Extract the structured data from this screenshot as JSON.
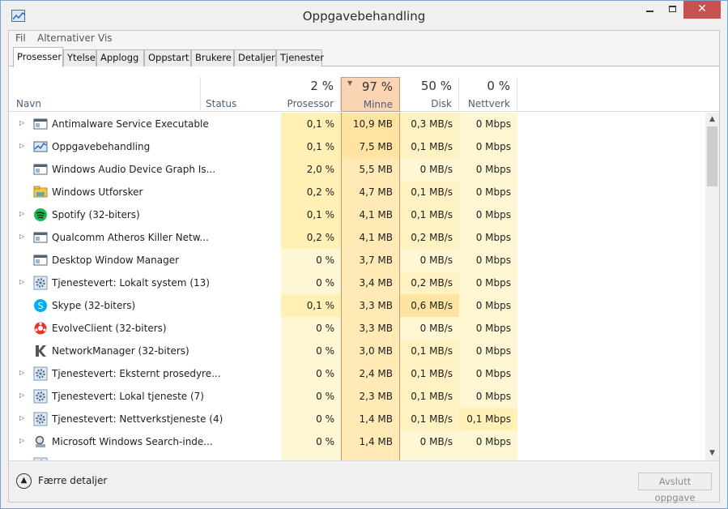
{
  "window": {
    "title": "Oppgavebehandling",
    "icon": "task-manager-icon",
    "min": "minimize-icon",
    "max": "maximize-icon",
    "close": "✕"
  },
  "menu": [
    "Fil",
    "Alternativer",
    "Vis"
  ],
  "tabs": [
    {
      "label": "Prosesser",
      "active": true
    },
    {
      "label": "Ytelse"
    },
    {
      "label": "Applogg"
    },
    {
      "label": "Oppstart"
    },
    {
      "label": "Brukere"
    },
    {
      "label": "Detaljer"
    },
    {
      "label": "Tjenester"
    }
  ],
  "columns": {
    "name": "Navn",
    "status": "Status",
    "cpu": {
      "pct": "2 %",
      "label": "Prosessor"
    },
    "memory": {
      "pct": "97 %",
      "label": "Minne"
    },
    "disk": {
      "pct": "50 %",
      "label": "Disk"
    },
    "network": {
      "pct": "0 %",
      "label": "Nettverk"
    }
  },
  "colors": {
    "heat_light": "#fff4c4",
    "heat_medium": "#ffe8a4",
    "heat_sorted": "#fbd5b3",
    "accent_border": "#e0906a",
    "close_red": "#c75050"
  },
  "processes": [
    {
      "name": "Antimalware Service Executable",
      "icon": "app-window-icon",
      "expandable": true,
      "cpu": "0,1 %",
      "mem": "10,9 MB",
      "disk": "0,3 MB/s",
      "net": "0 Mbps"
    },
    {
      "name": "Oppgavebehandling",
      "icon": "task-manager-icon",
      "expandable": true,
      "cpu": "0,1 %",
      "mem": "7,5 MB",
      "disk": "0,1 MB/s",
      "net": "0 Mbps"
    },
    {
      "name": "Windows Audio Device Graph Is...",
      "icon": "app-window-icon",
      "expandable": false,
      "cpu": "2,0 %",
      "mem": "5,5 MB",
      "disk": "0 MB/s",
      "net": "0 Mbps"
    },
    {
      "name": "Windows Utforsker",
      "icon": "explorer-icon",
      "expandable": false,
      "cpu": "0,2 %",
      "mem": "4,7 MB",
      "disk": "0,1 MB/s",
      "net": "0 Mbps"
    },
    {
      "name": "Spotify (32-biters)",
      "icon": "spotify-icon",
      "expandable": true,
      "cpu": "0,1 %",
      "mem": "4,1 MB",
      "disk": "0,1 MB/s",
      "net": "0 Mbps"
    },
    {
      "name": "Qualcomm Atheros Killer Netw...",
      "icon": "app-window-icon",
      "expandable": true,
      "cpu": "0,2 %",
      "mem": "4,1 MB",
      "disk": "0,2 MB/s",
      "net": "0 Mbps"
    },
    {
      "name": "Desktop Window Manager",
      "icon": "app-window-icon",
      "expandable": false,
      "cpu": "0 %",
      "mem": "3,7 MB",
      "disk": "0 MB/s",
      "net": "0 Mbps"
    },
    {
      "name": "Tjenestevert: Lokalt system (13)",
      "icon": "service-gear-icon",
      "expandable": true,
      "cpu": "0 %",
      "mem": "3,4 MB",
      "disk": "0,2 MB/s",
      "net": "0 Mbps"
    },
    {
      "name": "Skype (32-biters)",
      "icon": "skype-icon",
      "expandable": false,
      "cpu": "0,1 %",
      "mem": "3,3 MB",
      "disk": "0,6 MB/s",
      "net": "0 Mbps"
    },
    {
      "name": "EvolveClient (32-biters)",
      "icon": "evolve-icon",
      "expandable": false,
      "cpu": "0 %",
      "mem": "3,3 MB",
      "disk": "0 MB/s",
      "net": "0 Mbps"
    },
    {
      "name": "NetworkManager (32-biters)",
      "icon": "network-manager-icon",
      "expandable": false,
      "cpu": "0 %",
      "mem": "3,0 MB",
      "disk": "0,1 MB/s",
      "net": "0 Mbps"
    },
    {
      "name": "Tjenestevert: Eksternt prosedyre...",
      "icon": "service-gear-icon",
      "expandable": true,
      "cpu": "0 %",
      "mem": "2,4 MB",
      "disk": "0,1 MB/s",
      "net": "0 Mbps"
    },
    {
      "name": "Tjenestevert: Lokal tjeneste (7)",
      "icon": "service-gear-icon",
      "expandable": true,
      "cpu": "0 %",
      "mem": "2,3 MB",
      "disk": "0,1 MB/s",
      "net": "0 Mbps"
    },
    {
      "name": "Tjenestevert: Nettverkstjeneste (4)",
      "icon": "service-gear-icon",
      "expandable": true,
      "cpu": "0 %",
      "mem": "1,4 MB",
      "disk": "0,1 MB/s",
      "net": "0,1 Mbps"
    },
    {
      "name": "Microsoft Windows Search-inde...",
      "icon": "search-indexer-icon",
      "expandable": true,
      "cpu": "0 %",
      "mem": "1,4 MB",
      "disk": "0 MB/s",
      "net": "0 Mbps"
    },
    {
      "name": "",
      "icon": "service-gear-icon",
      "expandable": true,
      "cpu": "",
      "mem": "",
      "disk": "",
      "net": ""
    }
  ],
  "footer": {
    "fewer_details": "Færre detaljer",
    "end_task": "Avslutt oppgave"
  }
}
